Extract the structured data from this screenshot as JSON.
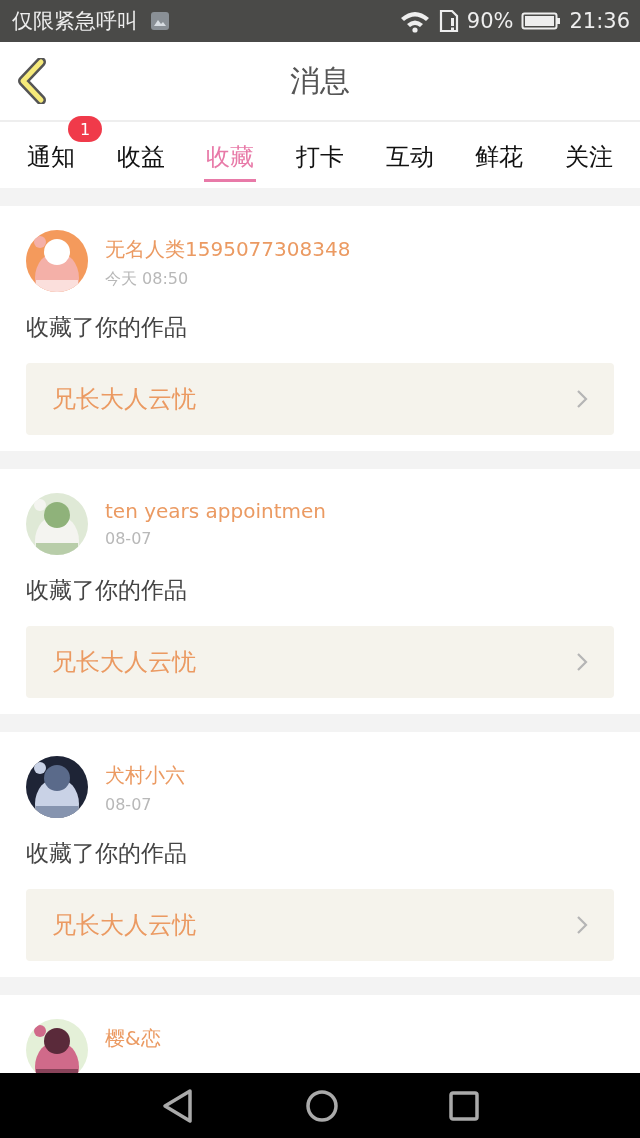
{
  "status_bar": {
    "carrier": "仅限紧急呼叫",
    "battery": "90%",
    "time": "21:36"
  },
  "header": {
    "title": "消息"
  },
  "tabs": [
    {
      "label": "通知",
      "selected": false,
      "badge": "1"
    },
    {
      "label": "收益",
      "selected": false
    },
    {
      "label": "收藏",
      "selected": true
    },
    {
      "label": "打卡",
      "selected": false
    },
    {
      "label": "互动",
      "selected": false
    },
    {
      "label": "鲜花",
      "selected": false
    },
    {
      "label": "关注",
      "selected": false
    }
  ],
  "messages": [
    {
      "user": "无名人类1595077308348",
      "time": "今天 08:50",
      "text": "收藏了你的作品",
      "work": "兄长大人云忧"
    },
    {
      "user": "ten years appointmen",
      "time": "08-07",
      "text": "收藏了你的作品",
      "work": "兄长大人云忧"
    },
    {
      "user": "犬村小六",
      "time": "08-07",
      "text": "收藏了你的作品",
      "work": "兄长大人云忧"
    },
    {
      "user": "樱&恋"
    }
  ]
}
